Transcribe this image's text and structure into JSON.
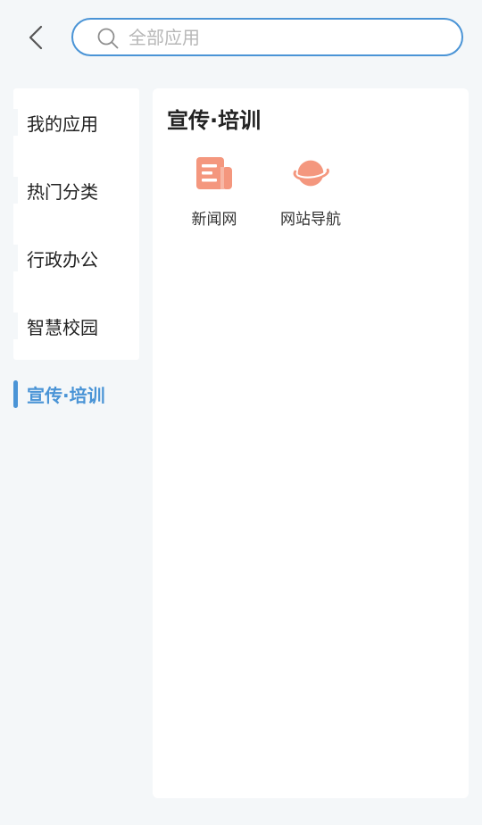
{
  "search": {
    "placeholder": "全部应用"
  },
  "sidebar": {
    "items": [
      {
        "label": "我的应用"
      },
      {
        "label": "热门分类"
      },
      {
        "label": "行政办公"
      },
      {
        "label": "智慧校园"
      }
    ],
    "active": {
      "label": "宣传·培训"
    }
  },
  "content": {
    "title": "宣传·培训",
    "apps": [
      {
        "label": "新闻网",
        "icon": "newspaper-icon"
      },
      {
        "label": "网站导航",
        "icon": "planet-icon"
      }
    ]
  },
  "colors": {
    "accent": "#4a94d6",
    "icon": "#f4977e",
    "background": "#f4f7f9"
  }
}
